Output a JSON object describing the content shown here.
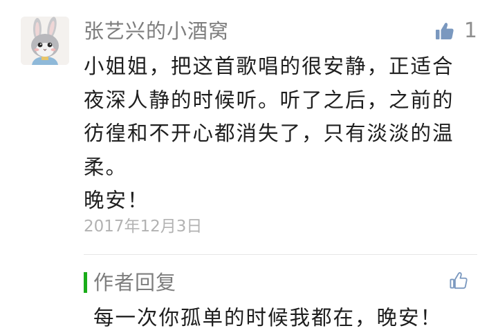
{
  "comment": {
    "avatar_icon": "bunny-avatar-icon",
    "nickname": "张艺兴的小酒窝",
    "like_icon": "thumbs-up-icon",
    "like_count": "1",
    "content_lines": [
      "小姐姐，把这首歌唱的很安静，正适合",
      "夜深人静的时候听。听了之后，之前的",
      "彷徨和不开心都消失了，只有淡淡的温",
      "柔。",
      "晚安！"
    ],
    "date": "2017年12月3日"
  },
  "reply": {
    "accent_color": "#1aad19",
    "title": "作者回复",
    "like_icon": "thumbs-up-outline-icon",
    "text": "每一次你孤单的时候我都在，晚安！"
  }
}
